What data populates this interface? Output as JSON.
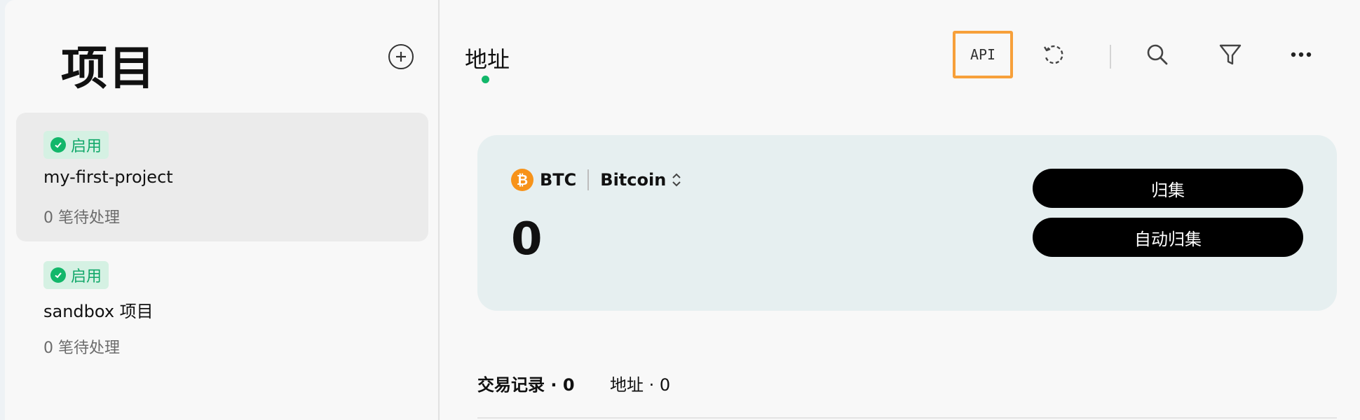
{
  "sidebar": {
    "title": "项目",
    "add_icon": "plus-circle-icon",
    "projects": [
      {
        "status": "启用",
        "name": "my-first-project",
        "pending": "0 笔待处理",
        "active": true
      },
      {
        "status": "启用",
        "name": "sandbox 项目",
        "pending": "0 笔待处理",
        "active": false
      }
    ]
  },
  "main": {
    "tab": "地址",
    "toolbar": {
      "api_label": "API",
      "icons": [
        "refresh-icon",
        "search-icon",
        "filter-icon",
        "more-icon"
      ]
    },
    "balance_card": {
      "asset_symbol": "BTC",
      "network_name": "Bitcoin",
      "balance": "0",
      "collect_label": "归集",
      "auto_collect_label": "自动归集"
    },
    "tabs": [
      {
        "label": "交易记录 · 0",
        "active": true
      },
      {
        "label": "地址 · 0",
        "active": false
      }
    ]
  },
  "colors": {
    "accent_green": "#12b76a",
    "api_highlight": "#f7a03a",
    "btc_orange": "#f7931a"
  }
}
